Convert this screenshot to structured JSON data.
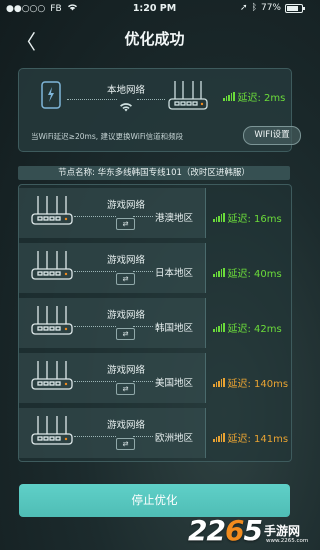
{
  "status_bar": {
    "carrier": "FB",
    "time": "1:20 PM",
    "battery": "77%",
    "battery_level": 0.77
  },
  "nav": {
    "back_glyph": "〈",
    "title": "优化成功"
  },
  "local": {
    "label": "本地网络",
    "delay": "延迟: 2ms",
    "tip": "当WiFi延迟≥20ms, 建议更换WiFi信道和频段",
    "wifi_button": "WIFI设置"
  },
  "node_name": "节点名称: 华东多线韩国专线101（改时区进韩服）",
  "regions": [
    {
      "game_label": "游戏网络",
      "region": "港澳地区",
      "delay": "延迟: 16ms",
      "status": "good"
    },
    {
      "game_label": "游戏网络",
      "region": "日本地区",
      "delay": "延迟: 40ms",
      "status": "good"
    },
    {
      "game_label": "游戏网络",
      "region": "韩国地区",
      "delay": "延迟: 42ms",
      "status": "good"
    },
    {
      "game_label": "游戏网络",
      "region": "美国地区",
      "delay": "延迟: 140ms",
      "status": "warn"
    },
    {
      "game_label": "游戏网络",
      "region": "欧洲地区",
      "delay": "延迟: 141ms",
      "status": "warn"
    }
  ],
  "arrow_glyph": "⇄",
  "stop_button": "停止优化",
  "watermark": {
    "logo": "2265",
    "text": "手游网",
    "url": "www.2265.com"
  },
  "colors": {
    "good": "#6bdc3a",
    "warn": "#e9a332",
    "accent": "#55c6be",
    "background": "#1c2b2d"
  },
  "icons": [
    "wifi-icon",
    "battery-icon",
    "back-icon",
    "phone-icon",
    "router-icon",
    "signal-icon",
    "arrow-icon"
  ]
}
